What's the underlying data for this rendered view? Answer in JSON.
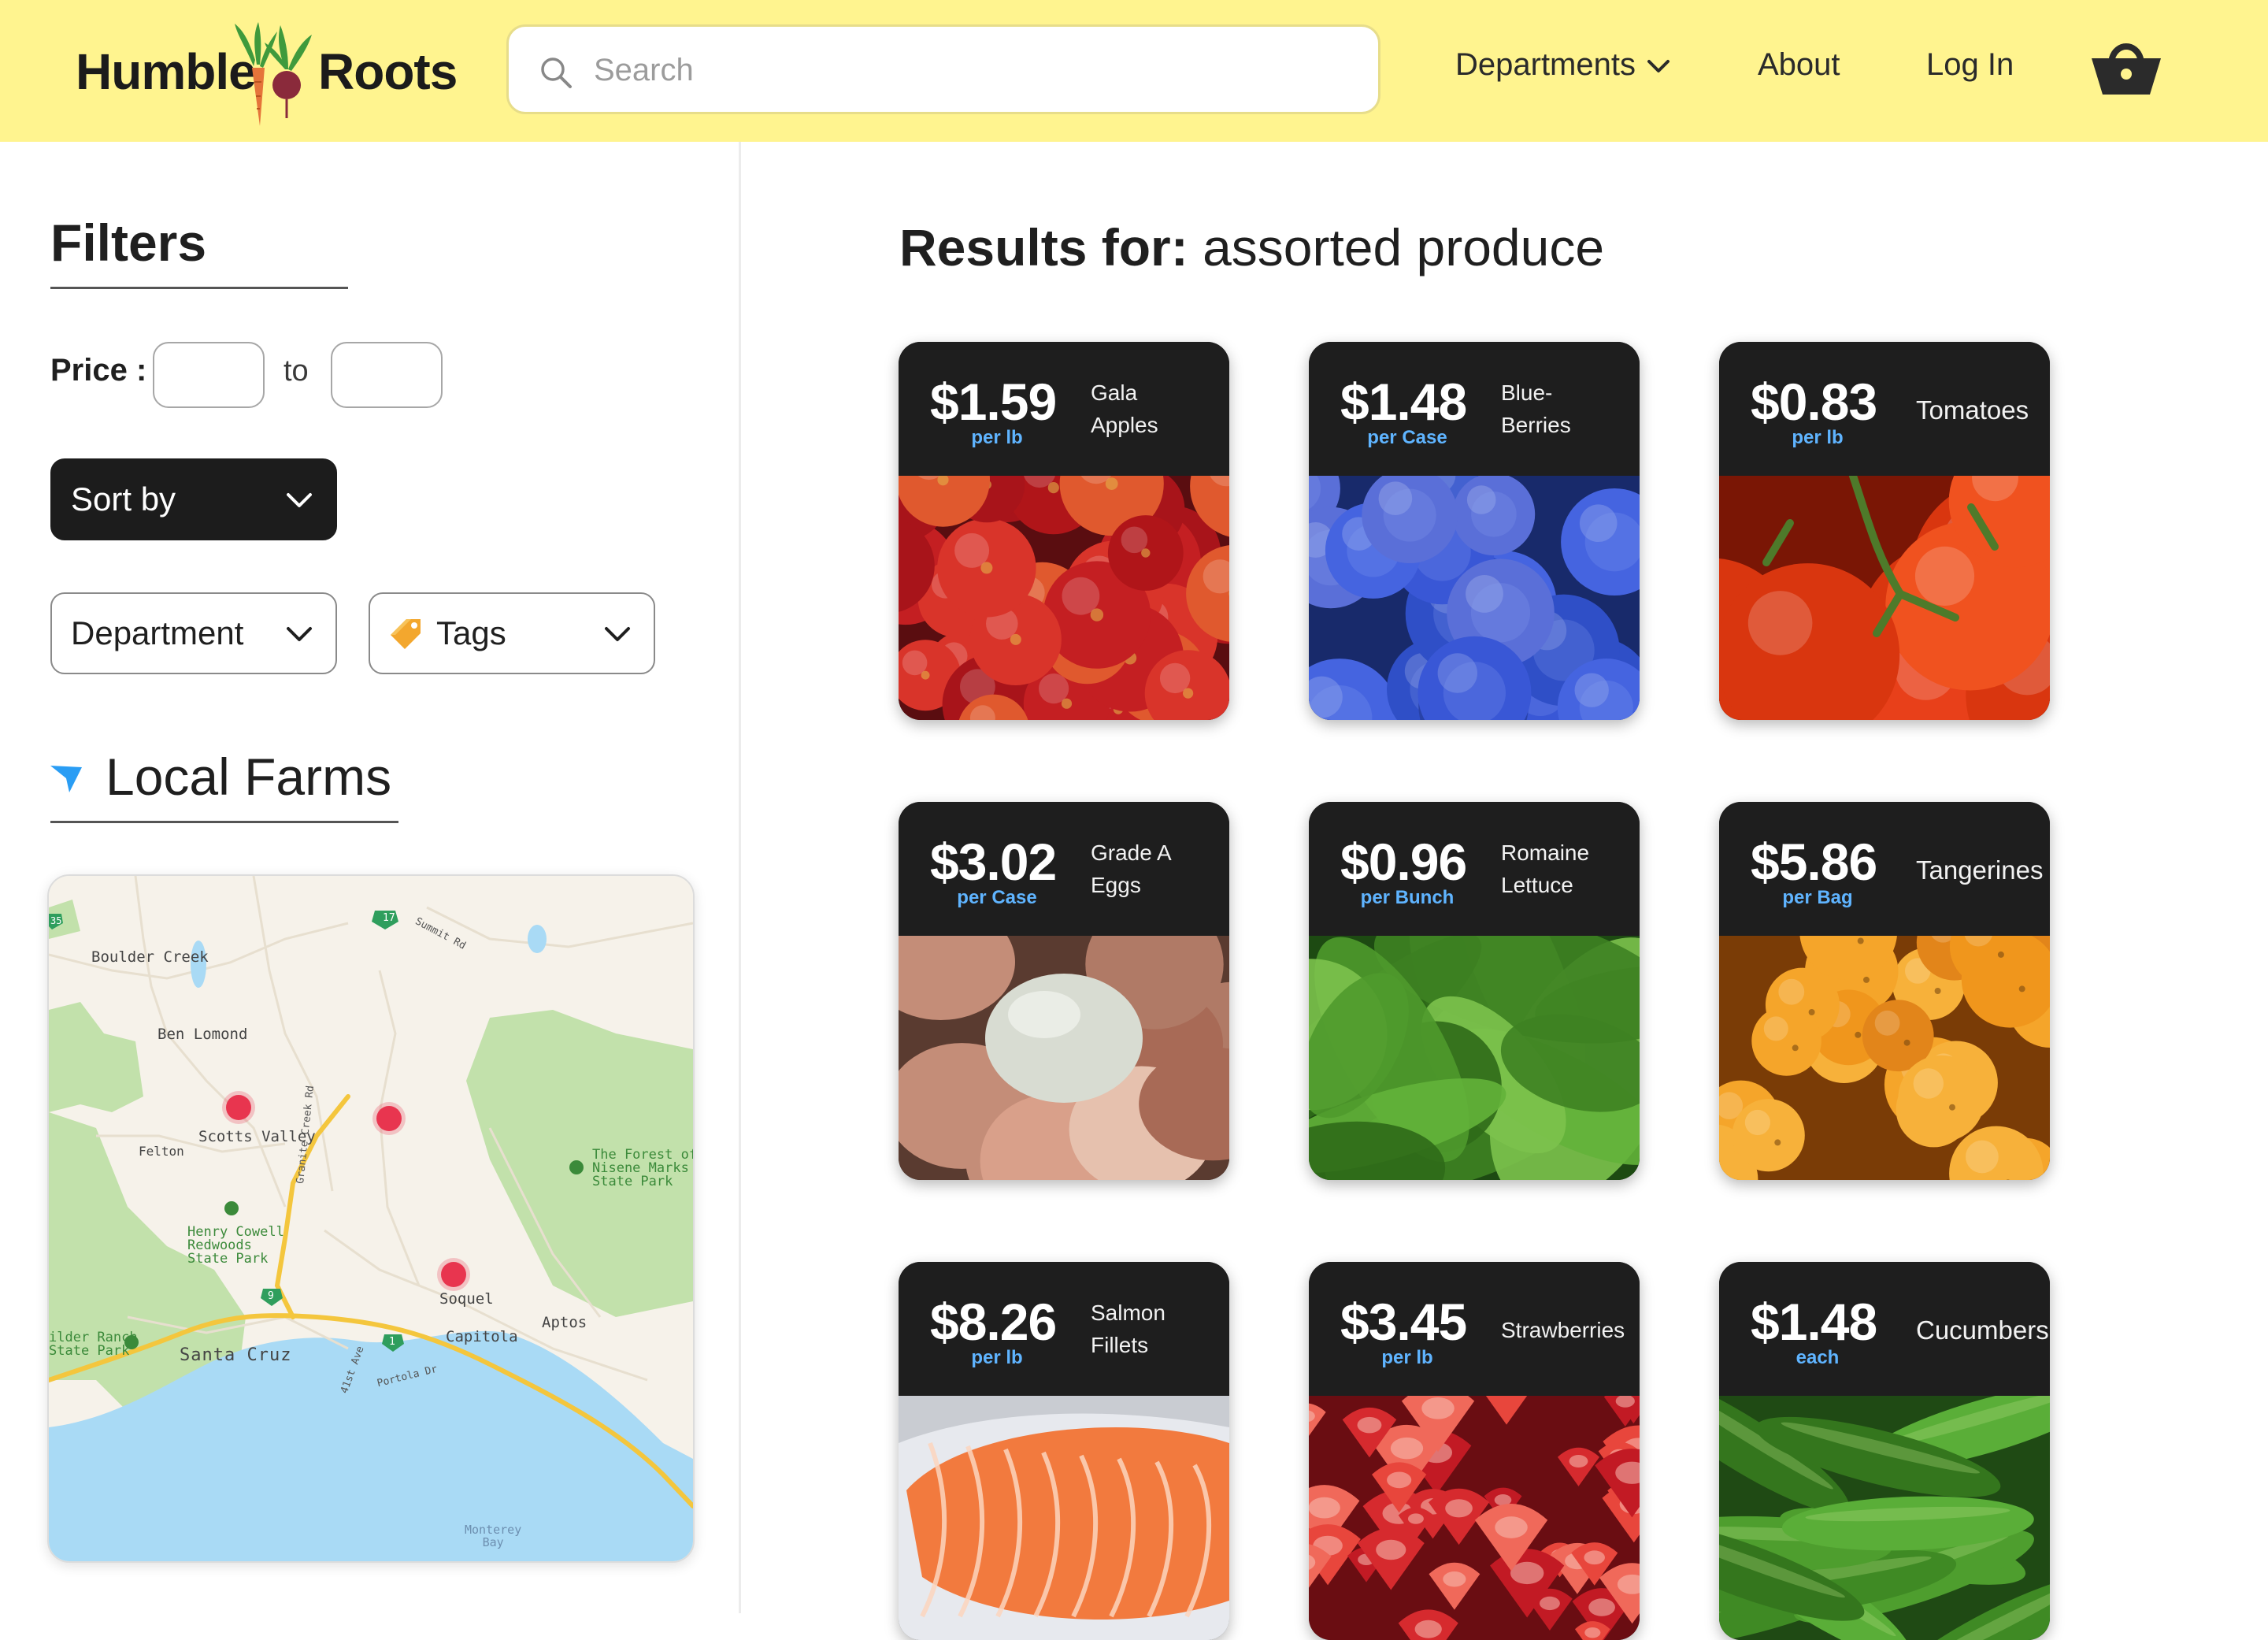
{
  "header": {
    "brand": {
      "word1": "Humble",
      "word2": "Roots"
    },
    "search": {
      "placeholder": "Search",
      "value": ""
    },
    "nav": {
      "departments": "Departments",
      "about": "About",
      "login": "Log In"
    }
  },
  "sidebar": {
    "filters_title": "Filters",
    "price_label": "Price :",
    "price_min": "",
    "price_max": "",
    "price_to": "to",
    "sort_by": "Sort by",
    "department": "Department",
    "tags": "Tags",
    "local_farms_title": "Local Farms",
    "map_labels": {
      "boulder_creek": "Boulder Creek",
      "ben_lomond": "Ben Lomond",
      "scotts_valley": "Scotts Valley",
      "felton": "Felton",
      "henry_cowell": "Henry Cowell\nRedwoods\nState Park",
      "forest_nisene": "The Forest of\nNisene Marks\nState Park",
      "soquel": "Soquel",
      "capitola": "Capitola",
      "aptos": "Aptos",
      "santa_cruz": "Santa Cruz",
      "wilder_ranch": "ilder Ranch\nState Park",
      "summit_rd": "Summit Rd",
      "granite_creek_rd": "Granite Creek Rd",
      "ave_41st": "41st Ave",
      "portola_dr": "Portola Dr",
      "monterey_bay": "Monterey\nBay",
      "route_17": "17",
      "route_9": "9",
      "route_1": "1",
      "route_35": "35"
    }
  },
  "results": {
    "prefix": "Results for:",
    "query": "assorted produce",
    "products": [
      {
        "price": "$1.59",
        "unit": "per lb",
        "name": "Gala\nApples",
        "image": "apples"
      },
      {
        "price": "$1.48",
        "unit": "per Case",
        "name": "Blue-\nBerries",
        "image": "blueberries"
      },
      {
        "price": "$0.83",
        "unit": "per lb",
        "name": "Tomatoes",
        "image": "tomatoes"
      },
      {
        "price": "$3.02",
        "unit": "per Case",
        "name": "Grade A\nEggs",
        "image": "eggs"
      },
      {
        "price": "$0.96",
        "unit": "per Bunch",
        "name": "Romaine\nLettuce",
        "image": "lettuce"
      },
      {
        "price": "$5.86",
        "unit": "per Bag",
        "name": "Tangerines",
        "image": "tangerines"
      },
      {
        "price": "$8.26",
        "unit": "per lb",
        "name": "Salmon\nFillets",
        "image": "salmon"
      },
      {
        "price": "$3.45",
        "unit": "per lb",
        "name": "Strawberries",
        "image": "strawberries"
      },
      {
        "price": "$1.48",
        "unit": "each",
        "name": "Cucumbers",
        "image": "cucumbers"
      }
    ]
  },
  "colors": {
    "header_bg": "#fff48f",
    "card_bg": "#1e1e1e",
    "unit_blue": "#5fb4ff",
    "pin_red": "#e8354f",
    "location_blue": "#2a9df4"
  },
  "icons": [
    "search-icon",
    "chevron-down-icon",
    "basket-icon",
    "tag-icon",
    "location-arrow-icon",
    "map-pin-icon"
  ]
}
